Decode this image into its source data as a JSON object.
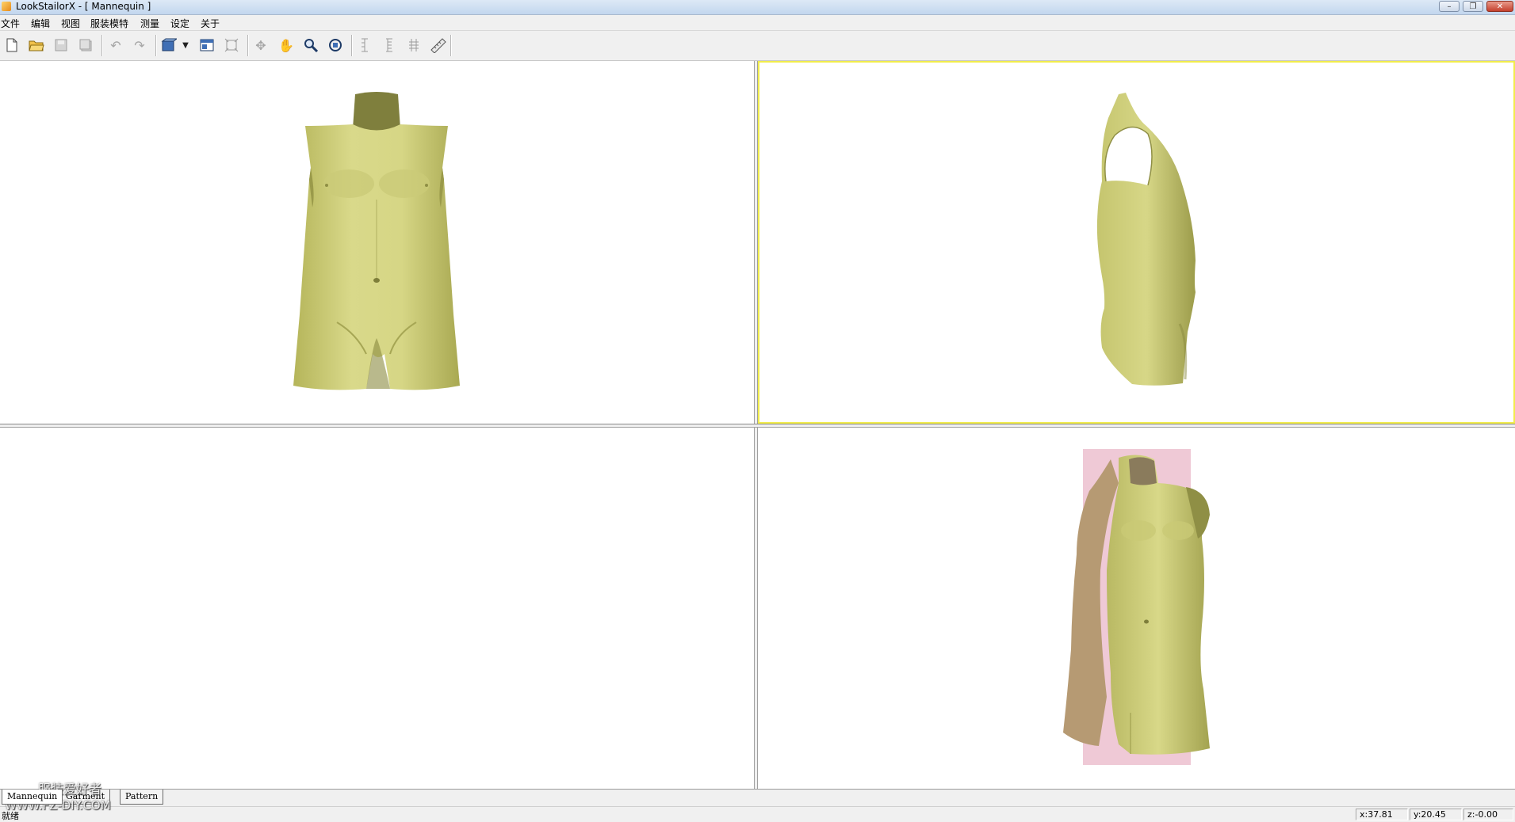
{
  "window": {
    "title": "LookStailorX - [ Mannequin ]",
    "minimize_glyph": "–",
    "restore_glyph": "❐",
    "close_glyph": "✕"
  },
  "menu": {
    "items": [
      "文件",
      "编辑",
      "视图",
      "服装模特",
      "测量",
      "设定",
      "关于"
    ]
  },
  "toolbar": {
    "icons": [
      "new-file-icon",
      "open-folder-icon",
      "save-icon",
      "save-all-icon",
      "undo-icon",
      "redo-icon",
      "display-mode-icon",
      "dropdown-arrow-icon",
      "layout-icon",
      "fit-icon",
      "rotate-icon",
      "pan-hand-icon",
      "zoom-icon",
      "view-reset-icon",
      "measure-vertical-icon",
      "measure-vertical-2-icon",
      "measure-split-icon",
      "ruler-icon"
    ]
  },
  "viewports": {
    "front": {
      "label": "front-view"
    },
    "side": {
      "label": "side-view",
      "active": true,
      "active_border_color": "#f1ec4c"
    },
    "empty": {
      "label": "empty-view"
    },
    "perspective": {
      "label": "perspective-view"
    }
  },
  "colors": {
    "mannequin_body": "#cfcf7a",
    "mannequin_shadow": "#8f8f45",
    "perspective_backdrop": "#efc9d6"
  },
  "tabs": [
    "Mannequin",
    "Garment",
    "Pattern"
  ],
  "status": {
    "left": "就绪",
    "x": "x:37.81",
    "y": "y:20.45",
    "z": "z:-0.00"
  },
  "watermark": {
    "line1": "服装爱好者",
    "line2": "WWW.FZ-DIY.COM"
  }
}
